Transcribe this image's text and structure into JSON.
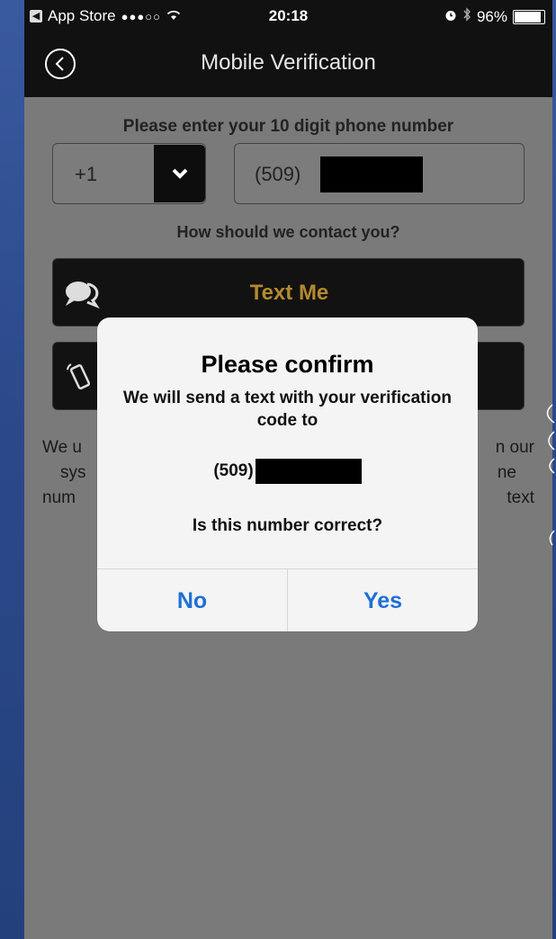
{
  "status_bar": {
    "back_app": "App Store",
    "signal": "●●●○○",
    "time": "20:18",
    "battery_percent": "96%",
    "battery_level": 0.96
  },
  "nav": {
    "title": "Mobile Verification"
  },
  "form": {
    "phone_prompt": "Please enter your 10 digit phone number",
    "country_code": "+1",
    "area_code": "(509)",
    "contact_prompt": "How should we contact you?",
    "text_me_label": "Text Me"
  },
  "info": {
    "line1_left": "We u",
    "line1_right": "n our",
    "line2_left": "sys",
    "line2_right": "ne",
    "line3_left": "num",
    "line3_right": "text"
  },
  "dialog": {
    "title": "Please confirm",
    "message": "We will send a text with your verification code to",
    "area_code": "(509)",
    "question": "Is this number correct?",
    "no_label": "No",
    "yes_label": "Yes"
  },
  "colors": {
    "accent_gold": "#b38a2e",
    "ios_blue": "#1f6fd6",
    "background_blue": "#2c4a8c"
  }
}
